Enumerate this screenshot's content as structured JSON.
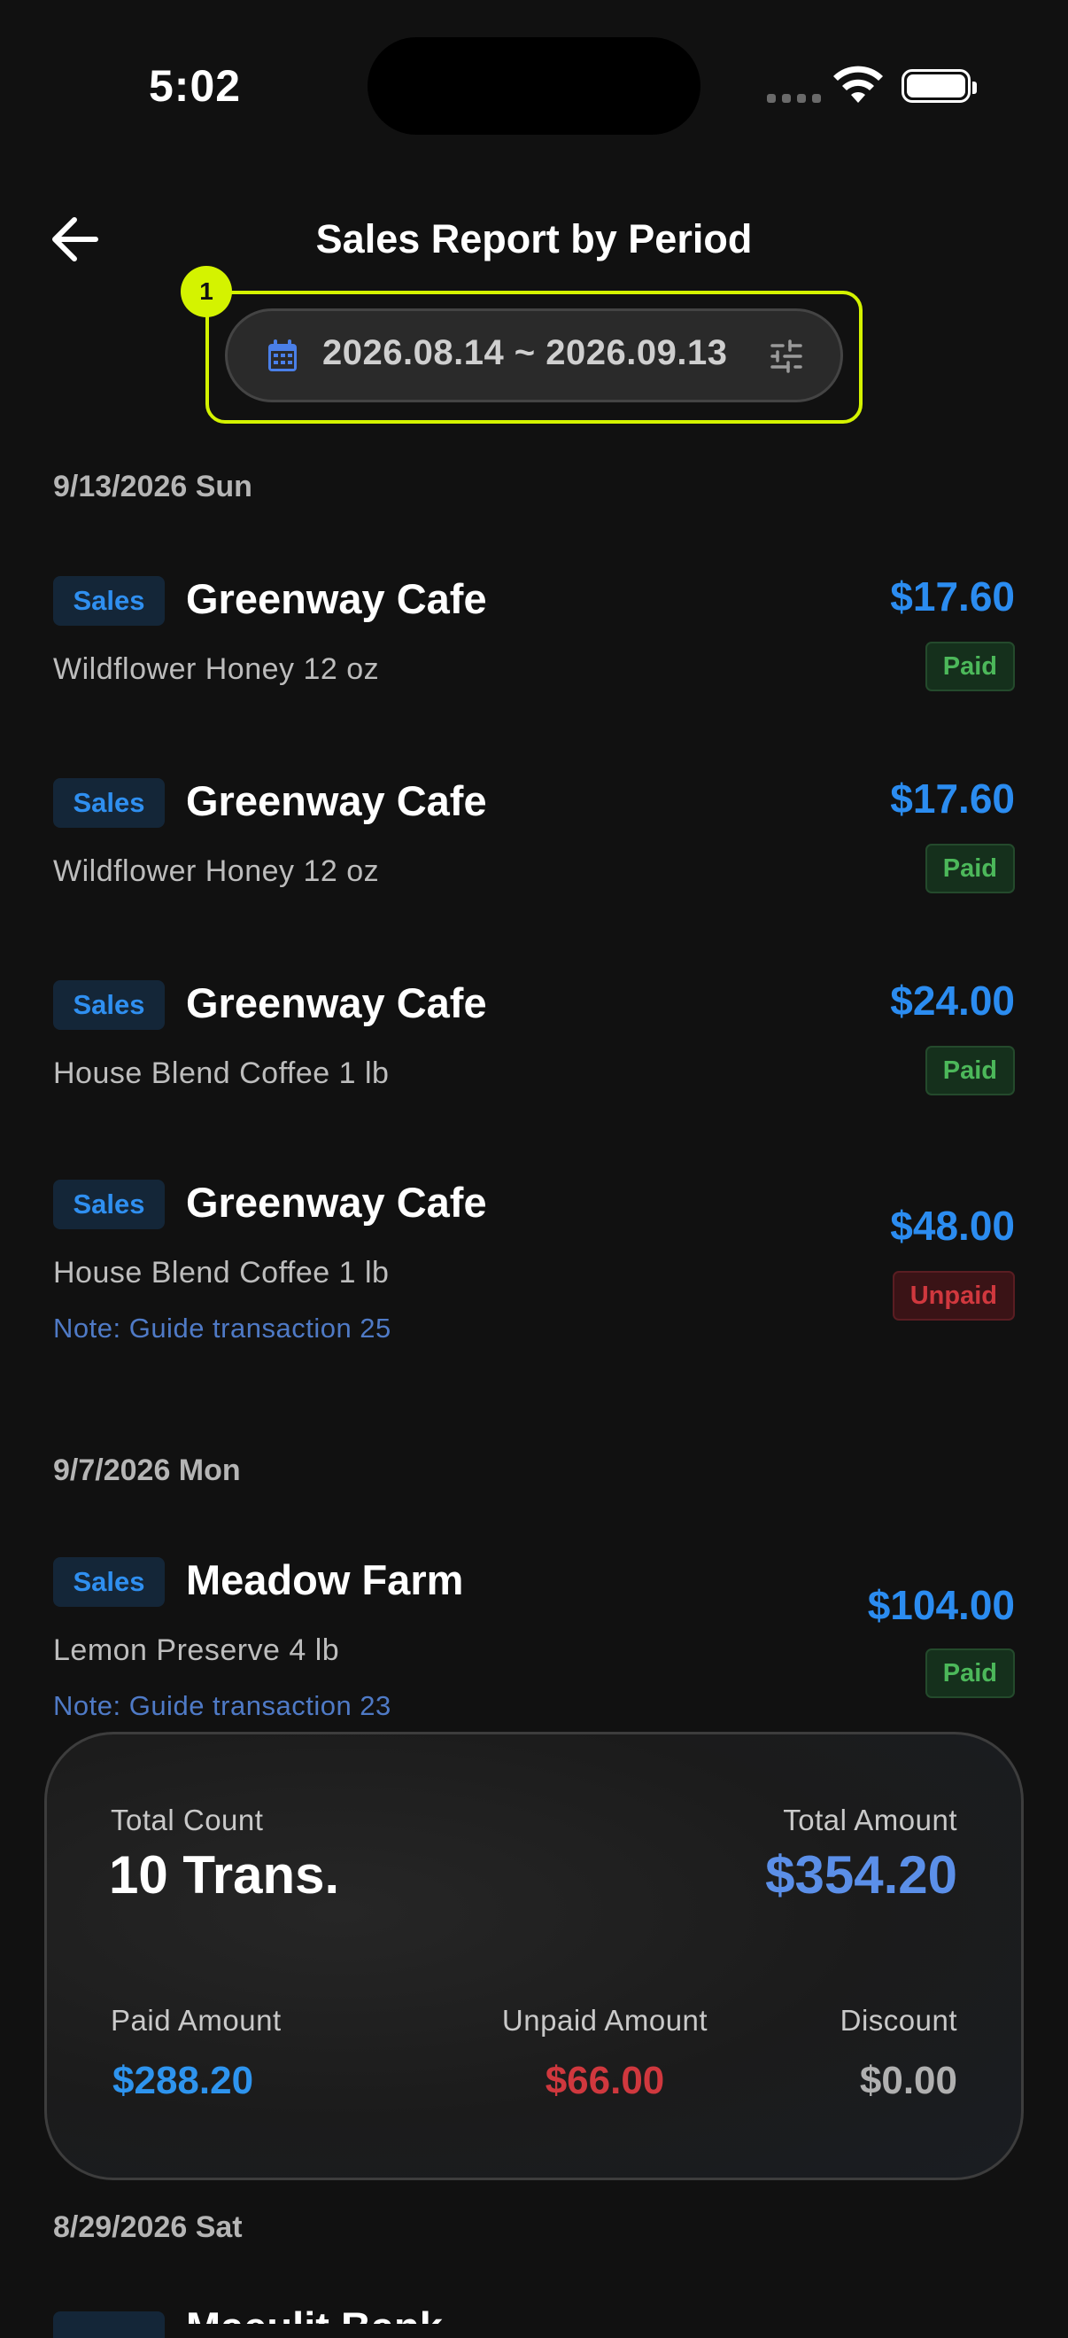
{
  "status_bar": {
    "time": "5:02"
  },
  "header": {
    "title": "Sales Report by Period",
    "step_badge": "1"
  },
  "date_range": {
    "label": "2026.08.14 ~ 2026.09.13"
  },
  "groups": [
    {
      "date": "9/13/2026 Sun",
      "transactions": [
        {
          "tag": "Sales",
          "name": "Greenway Cafe",
          "item": "Wildflower Honey 12 oz",
          "amount": "$17.60",
          "status": "Paid"
        },
        {
          "tag": "Sales",
          "name": "Greenway Cafe",
          "item": "Wildflower Honey 12 oz",
          "amount": "$17.60",
          "status": "Paid"
        },
        {
          "tag": "Sales",
          "name": "Greenway Cafe",
          "item": "House Blend Coffee 1 lb",
          "amount": "$24.00",
          "status": "Paid"
        },
        {
          "tag": "Sales",
          "name": "Greenway Cafe",
          "item": "House Blend Coffee 1 lb",
          "note": "Note: Guide transaction 25",
          "amount": "$48.00",
          "status": "Unpaid"
        }
      ]
    },
    {
      "date": "9/7/2026 Mon",
      "transactions": [
        {
          "tag": "Sales",
          "name": "Meadow Farm",
          "item": "Lemon Preserve 4 lb",
          "note": "Note: Guide transaction 23",
          "amount": "$104.00",
          "status": "Paid"
        }
      ]
    },
    {
      "date": "8/29/2026 Sat",
      "transactions": [
        {
          "name": "Maeulit Bank"
        }
      ]
    }
  ],
  "summary": {
    "total_count_label": "Total Count",
    "total_count": "10 Trans.",
    "total_amount_label": "Total Amount",
    "total_amount": "$354.20",
    "paid_label": "Paid Amount",
    "paid": "$288.20",
    "unpaid_label": "Unpaid Amount",
    "unpaid": "$66.00",
    "discount_label": "Discount",
    "discount": "$0.00"
  },
  "colors": {
    "accent_blue": "#2b8cf0",
    "paid_green": "#4cb85a",
    "unpaid_red": "#d0383e",
    "highlight": "#d4f300"
  }
}
